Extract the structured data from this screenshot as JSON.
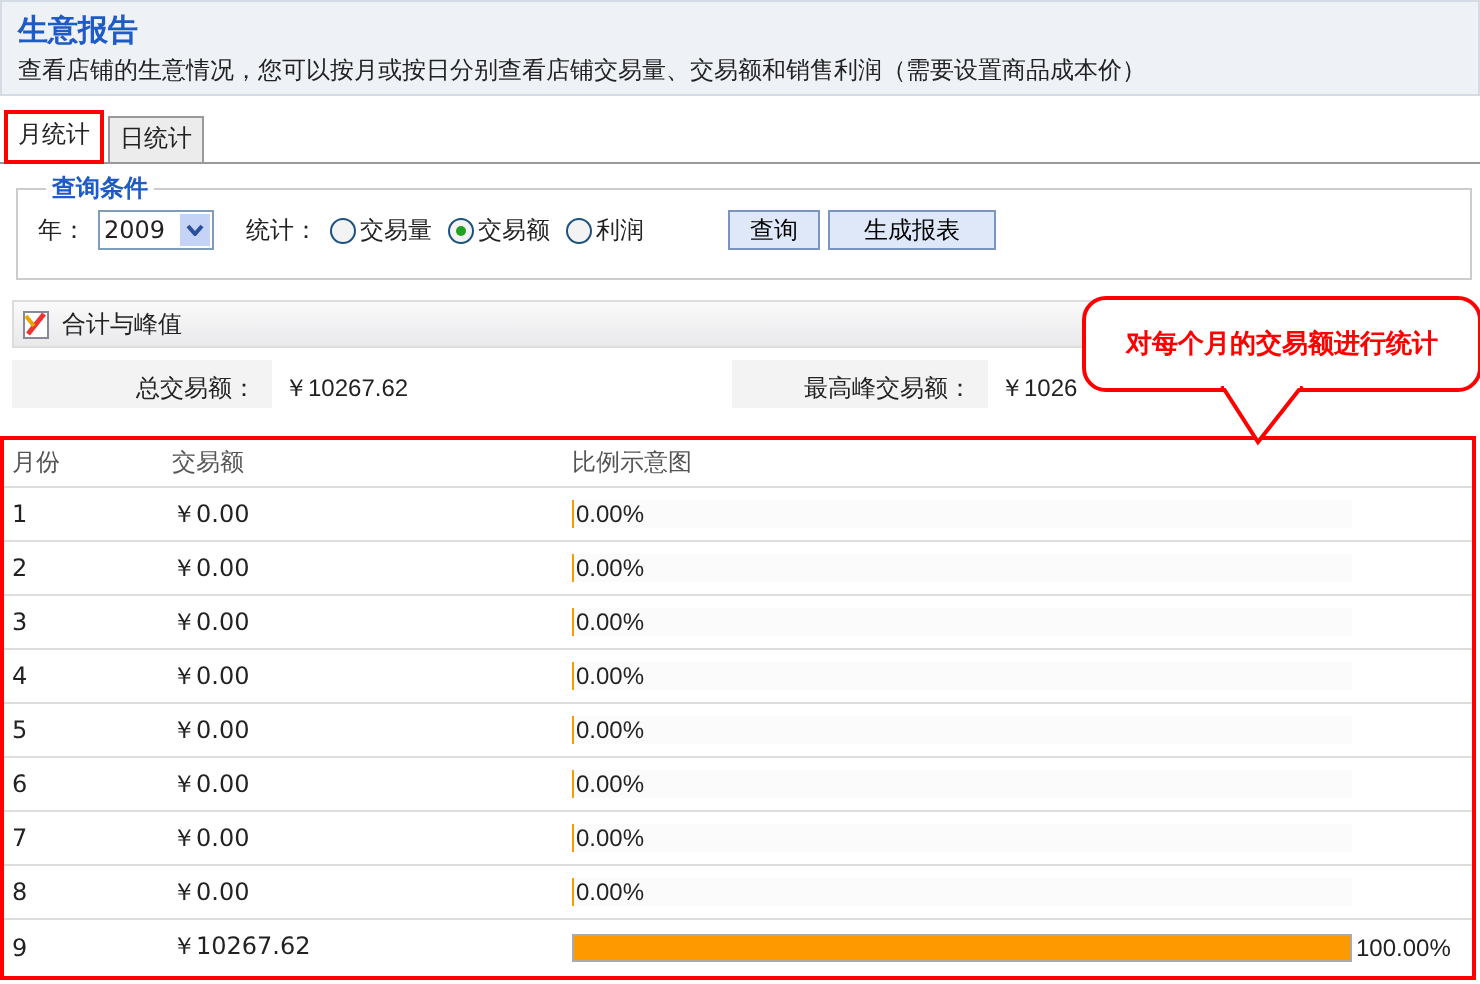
{
  "header": {
    "title": "生意报告",
    "description": "查看店铺的生意情况，您可以按月或按日分别查看店铺交易量、交易额和销售利润（需要设置商品成本价）"
  },
  "tabs": [
    {
      "label": "月统计",
      "selected": true
    },
    {
      "label": "日统计",
      "selected": false
    }
  ],
  "query": {
    "legend": "查询条件",
    "year_label": "年：",
    "year": "2009",
    "stat_label": "统计：",
    "options": [
      {
        "label": "交易量",
        "selected": false
      },
      {
        "label": "交易额",
        "selected": true
      },
      {
        "label": "利润",
        "selected": false
      }
    ],
    "buttons": [
      "查询",
      "生成报表"
    ]
  },
  "summary": {
    "title": "合计与峰值",
    "total_label": "总交易额：",
    "total_value": "￥10267.62",
    "peak_label": "最高峰交易额：",
    "peak_value": "￥1026"
  },
  "callout": {
    "text": "对每个月的交易额进行统计"
  },
  "table": {
    "columns": [
      "月份",
      "交易额",
      "比例示意图"
    ],
    "rows": [
      {
        "month": "1",
        "amount": "￥0.00",
        "level": 0,
        "percent": "0.00%"
      },
      {
        "month": "2",
        "amount": "￥0.00",
        "level": 0,
        "percent": "0.00%"
      },
      {
        "month": "3",
        "amount": "￥0.00",
        "level": 0,
        "percent": "0.00%"
      },
      {
        "month": "4",
        "amount": "￥0.00",
        "level": 0,
        "percent": "0.00%"
      },
      {
        "month": "5",
        "amount": "￥0.00",
        "level": 0,
        "percent": "0.00%"
      },
      {
        "month": "6",
        "amount": "￥0.00",
        "level": 0,
        "percent": "0.00%"
      },
      {
        "month": "7",
        "amount": "￥0.00",
        "level": 0,
        "percent": "0.00%"
      },
      {
        "month": "8",
        "amount": "￥0.00",
        "level": 0,
        "percent": "0.00%"
      },
      {
        "month": "9",
        "amount": "￥10267.62",
        "level": 1,
        "percent": "100.00%"
      }
    ]
  }
}
